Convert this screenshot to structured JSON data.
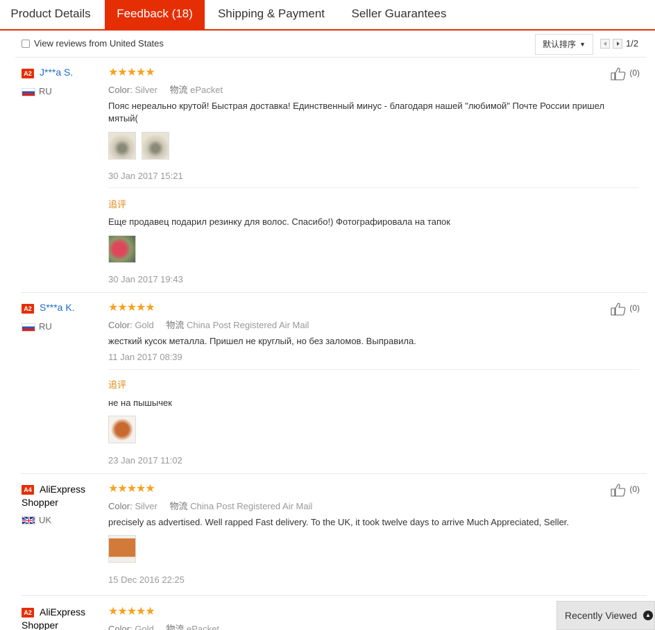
{
  "tabs": [
    {
      "label": "Product Details"
    },
    {
      "label": "Feedback (18)"
    },
    {
      "label": "Shipping & Payment"
    },
    {
      "label": "Seller Guarantees"
    }
  ],
  "filter": {
    "checkbox_label": "View reviews from United States",
    "sort_label": "默认排序",
    "page": "1/2"
  },
  "labels": {
    "color_key": "Color:",
    "logistics_key": "物流",
    "additional_feedback": "追评",
    "stars": "★★★★★"
  },
  "reviews": [
    {
      "badge": "A2",
      "user": "J***a S.",
      "country": "RU",
      "color": "Silver",
      "shipping": "ePacket",
      "likes": "(0)",
      "text": "Пояс нереально крутой! Быстрая доставка! Единственный минус - благодаря нашей \"любимой\" Почте России пришел мятый(",
      "date": "30 Jan 2017 15:21",
      "followup_text": "Еще продавец подарил резинку для волос. Спасибо!) Фотографировала на тапок",
      "followup_date": "30 Jan 2017 19:43"
    },
    {
      "badge": "A2",
      "user": "S***a K.",
      "country": "RU",
      "color": "Gold",
      "shipping": "China Post Registered Air Mail",
      "likes": "(0)",
      "text": "жесткий кусок металла. Пришел не круглый, но без заломов. Выправила.",
      "date": "11 Jan 2017 08:39",
      "followup_text": "не на пышычек",
      "followup_date": "23 Jan 2017 11:02"
    },
    {
      "badge": "A4",
      "user_line1": "AliExpress",
      "user_line2": "Shopper",
      "country": "UK",
      "color": "Silver",
      "shipping": "China Post Registered Air Mail",
      "likes": "(0)",
      "text": "precisely as advertised. Well rapped Fast delivery. To the UK, it took twelve days to arrive Much Appreciated, Seller.",
      "date": "15 Dec 2016 22:25"
    },
    {
      "badge": "A2",
      "user_line1": "AliExpress",
      "user_line2": "Shopper",
      "color": "Gold",
      "shipping": "ePacket"
    }
  ],
  "recently_viewed": "Recently Viewed"
}
